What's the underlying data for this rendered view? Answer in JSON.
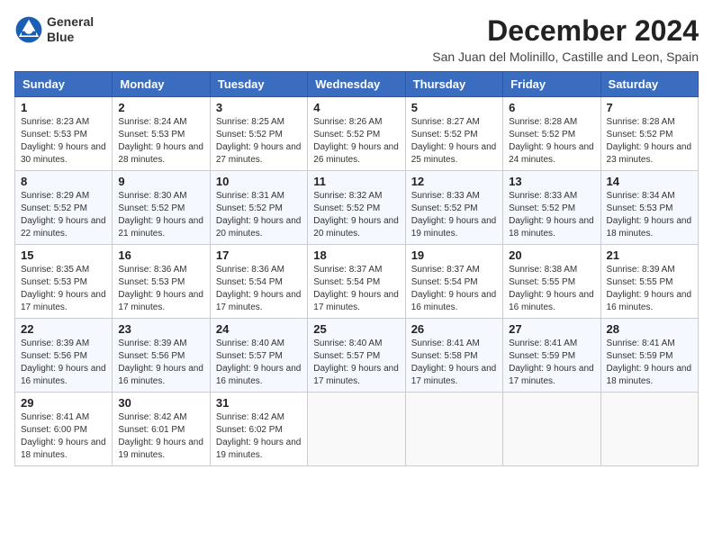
{
  "header": {
    "logo_line1": "General",
    "logo_line2": "Blue",
    "title": "December 2024",
    "subtitle": "San Juan del Molinillo, Castille and Leon, Spain"
  },
  "columns": [
    "Sunday",
    "Monday",
    "Tuesday",
    "Wednesday",
    "Thursday",
    "Friday",
    "Saturday"
  ],
  "weeks": [
    [
      {
        "day": "1",
        "sunrise": "8:23 AM",
        "sunset": "5:53 PM",
        "daylight": "9 hours and 30 minutes."
      },
      {
        "day": "2",
        "sunrise": "8:24 AM",
        "sunset": "5:53 PM",
        "daylight": "9 hours and 28 minutes."
      },
      {
        "day": "3",
        "sunrise": "8:25 AM",
        "sunset": "5:52 PM",
        "daylight": "9 hours and 27 minutes."
      },
      {
        "day": "4",
        "sunrise": "8:26 AM",
        "sunset": "5:52 PM",
        "daylight": "9 hours and 26 minutes."
      },
      {
        "day": "5",
        "sunrise": "8:27 AM",
        "sunset": "5:52 PM",
        "daylight": "9 hours and 25 minutes."
      },
      {
        "day": "6",
        "sunrise": "8:28 AM",
        "sunset": "5:52 PM",
        "daylight": "9 hours and 24 minutes."
      },
      {
        "day": "7",
        "sunrise": "8:28 AM",
        "sunset": "5:52 PM",
        "daylight": "9 hours and 23 minutes."
      }
    ],
    [
      {
        "day": "8",
        "sunrise": "8:29 AM",
        "sunset": "5:52 PM",
        "daylight": "9 hours and 22 minutes."
      },
      {
        "day": "9",
        "sunrise": "8:30 AM",
        "sunset": "5:52 PM",
        "daylight": "9 hours and 21 minutes."
      },
      {
        "day": "10",
        "sunrise": "8:31 AM",
        "sunset": "5:52 PM",
        "daylight": "9 hours and 20 minutes."
      },
      {
        "day": "11",
        "sunrise": "8:32 AM",
        "sunset": "5:52 PM",
        "daylight": "9 hours and 20 minutes."
      },
      {
        "day": "12",
        "sunrise": "8:33 AM",
        "sunset": "5:52 PM",
        "daylight": "9 hours and 19 minutes."
      },
      {
        "day": "13",
        "sunrise": "8:33 AM",
        "sunset": "5:52 PM",
        "daylight": "9 hours and 18 minutes."
      },
      {
        "day": "14",
        "sunrise": "8:34 AM",
        "sunset": "5:53 PM",
        "daylight": "9 hours and 18 minutes."
      }
    ],
    [
      {
        "day": "15",
        "sunrise": "8:35 AM",
        "sunset": "5:53 PM",
        "daylight": "9 hours and 17 minutes."
      },
      {
        "day": "16",
        "sunrise": "8:36 AM",
        "sunset": "5:53 PM",
        "daylight": "9 hours and 17 minutes."
      },
      {
        "day": "17",
        "sunrise": "8:36 AM",
        "sunset": "5:54 PM",
        "daylight": "9 hours and 17 minutes."
      },
      {
        "day": "18",
        "sunrise": "8:37 AM",
        "sunset": "5:54 PM",
        "daylight": "9 hours and 17 minutes."
      },
      {
        "day": "19",
        "sunrise": "8:37 AM",
        "sunset": "5:54 PM",
        "daylight": "9 hours and 16 minutes."
      },
      {
        "day": "20",
        "sunrise": "8:38 AM",
        "sunset": "5:55 PM",
        "daylight": "9 hours and 16 minutes."
      },
      {
        "day": "21",
        "sunrise": "8:39 AM",
        "sunset": "5:55 PM",
        "daylight": "9 hours and 16 minutes."
      }
    ],
    [
      {
        "day": "22",
        "sunrise": "8:39 AM",
        "sunset": "5:56 PM",
        "daylight": "9 hours and 16 minutes."
      },
      {
        "day": "23",
        "sunrise": "8:39 AM",
        "sunset": "5:56 PM",
        "daylight": "9 hours and 16 minutes."
      },
      {
        "day": "24",
        "sunrise": "8:40 AM",
        "sunset": "5:57 PM",
        "daylight": "9 hours and 16 minutes."
      },
      {
        "day": "25",
        "sunrise": "8:40 AM",
        "sunset": "5:57 PM",
        "daylight": "9 hours and 17 minutes."
      },
      {
        "day": "26",
        "sunrise": "8:41 AM",
        "sunset": "5:58 PM",
        "daylight": "9 hours and 17 minutes."
      },
      {
        "day": "27",
        "sunrise": "8:41 AM",
        "sunset": "5:59 PM",
        "daylight": "9 hours and 17 minutes."
      },
      {
        "day": "28",
        "sunrise": "8:41 AM",
        "sunset": "5:59 PM",
        "daylight": "9 hours and 18 minutes."
      }
    ],
    [
      {
        "day": "29",
        "sunrise": "8:41 AM",
        "sunset": "6:00 PM",
        "daylight": "9 hours and 18 minutes."
      },
      {
        "day": "30",
        "sunrise": "8:42 AM",
        "sunset": "6:01 PM",
        "daylight": "9 hours and 19 minutes."
      },
      {
        "day": "31",
        "sunrise": "8:42 AM",
        "sunset": "6:02 PM",
        "daylight": "9 hours and 19 minutes."
      },
      null,
      null,
      null,
      null
    ]
  ],
  "labels": {
    "sunrise": "Sunrise:",
    "sunset": "Sunset:",
    "daylight": "Daylight:"
  }
}
